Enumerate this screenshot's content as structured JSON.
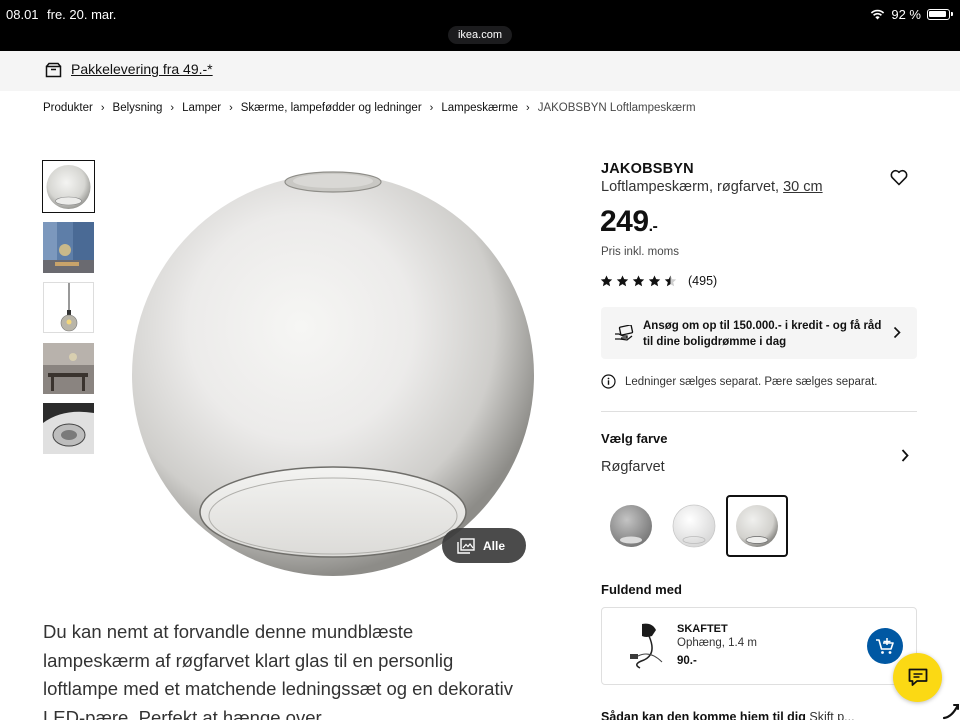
{
  "status_bar": {
    "time": "08.01",
    "date": "fre. 20. mar.",
    "url": "ikea.com",
    "battery": "92 %"
  },
  "promo": {
    "text": "Pakkelevering fra 49.-*"
  },
  "breadcrumb": [
    "Produkter",
    "Belysning",
    "Lamper",
    "Skærme, lampefødder og ledninger",
    "Lampeskærme",
    "JAKOBSBYN Loftlampeskærm"
  ],
  "gallery": {
    "thumbnails": [
      "product-globe-thumb",
      "room-blue-curtain-thumb",
      "pendant-lamp-thumb",
      "dining-room-thumb",
      "glass-closeup-thumb"
    ],
    "all_button": "Alle"
  },
  "description": "Du kan nemt at forvandle denne mundblæste lampeskærm af røgfarvet klart glas til en personlig loftlampe med et matchende ledningssæt og en dekorativ LED-pære. Perfekt at hænge over",
  "product": {
    "name": "JAKOBSBYN",
    "desc": "Loftlampeskærm, røgfarvet,",
    "size": "30 cm",
    "price": "249",
    "price_suffix": ".-",
    "price_note": "Pris inkl. moms",
    "rating": 4.5,
    "review_count": "(495)"
  },
  "credit": {
    "text": "Ansøg om op til 150.000.- i kredit - og få råd til dine boligdrømme i dag"
  },
  "info": {
    "text": "Ledninger sælges separat. Pære sælges separat."
  },
  "color": {
    "heading": "Vælg farve",
    "selected": "Røgfarvet",
    "options": [
      "grey-opaque",
      "clear-glass",
      "smoke-grey"
    ],
    "selected_index": 2
  },
  "complete": {
    "heading": "Fuldend med",
    "item": {
      "name": "SKAFTET",
      "desc": "Ophæng, 1.4 m",
      "price": "90.-"
    }
  },
  "bottom": {
    "text": "Sådan kan den komme hjem til dig",
    "extra": "Skift p..."
  },
  "colors": {
    "ikea_blue": "#0058a3",
    "ikea_yellow": "#fbd914"
  }
}
